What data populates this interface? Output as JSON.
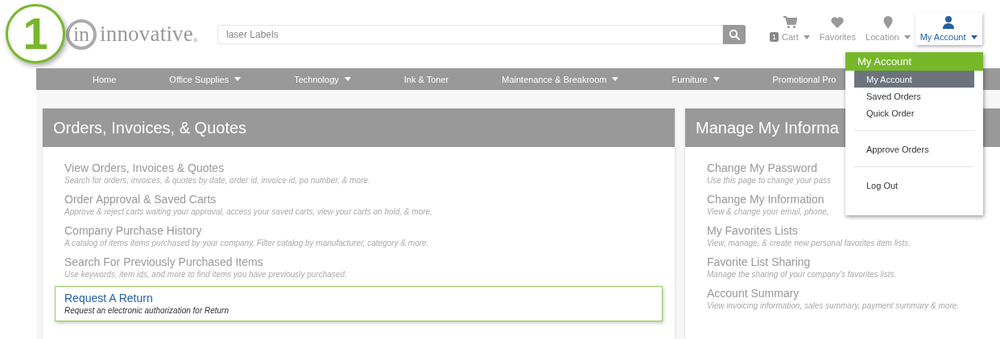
{
  "step_badge": "1",
  "logo": {
    "mark": "in",
    "name": "innovative",
    "reg": "®"
  },
  "search": {
    "value": "laser Labels"
  },
  "header_links": [
    {
      "kind": "cart",
      "count": "1",
      "label": "Cart",
      "caret": true,
      "selected": false
    },
    {
      "kind": "heart",
      "label": "Favorites",
      "caret": false,
      "selected": false
    },
    {
      "kind": "pin",
      "label": "Location",
      "caret": true,
      "selected": false
    },
    {
      "kind": "person",
      "label": "My Account",
      "caret": true,
      "selected": true
    }
  ],
  "nav": [
    {
      "label": "Home",
      "caret": false
    },
    {
      "label": "Office Supplies",
      "caret": true
    },
    {
      "label": "Technology",
      "caret": true
    },
    {
      "label": "Ink & Toner",
      "caret": false
    },
    {
      "label": "Maintenance & Breakroom",
      "caret": true
    },
    {
      "label": "Furniture",
      "caret": true
    },
    {
      "label": "Promotional Pro",
      "caret": false
    }
  ],
  "cards": [
    {
      "title": "Orders, Invoices, & Quotes",
      "items": [
        {
          "title": "View Orders, Invoices & Quotes",
          "description": "Search for orders, invoices, & quotes by date, order id, invoice id, po number, & more.",
          "selected": false
        },
        {
          "title": "Order Approval & Saved Carts",
          "description": "Approve & reject carts waiting your approval, access your saved carts, view your carts on hold, & more.",
          "selected": false
        },
        {
          "title": "Company Purchase History",
          "description": "A catalog of items items purchased by your company. Filter catalog by manufacturer, category & more.",
          "selected": false
        },
        {
          "title": "Search For Previously Purchased Items",
          "description": "Use keywords, item ids, and more to find items you have previously purchased.",
          "selected": false
        },
        {
          "title": "Request A Return",
          "description": "Request an electronic authorization for Return",
          "selected": true
        }
      ]
    },
    {
      "title": "Manage My Informa",
      "items": [
        {
          "title": "Change My Password",
          "description": "Use this page to change your pass",
          "selected": false
        },
        {
          "title": "Change My Information",
          "description": "View & change your email, phone,",
          "selected": false
        },
        {
          "title": "My Favorites Lists",
          "description": "View, manage, & create new personal favorites item lists.",
          "selected": false
        },
        {
          "title": "Favorite List Sharing",
          "description": "Manage the sharing of your company's favorites lists.",
          "selected": false
        },
        {
          "title": "Account Summary",
          "description": "View invoicing information, sales summary, payment summary & more.",
          "selected": false
        }
      ]
    }
  ],
  "account_menu": {
    "title": "My Account",
    "groups": [
      [
        {
          "label": "My Account",
          "selected": true
        },
        {
          "label": "Saved Orders",
          "selected": false
        },
        {
          "label": "Quick Order",
          "selected": false
        }
      ],
      [
        {
          "label": "Approve Orders",
          "selected": false
        }
      ],
      [
        {
          "label": "Log Out",
          "selected": false
        }
      ]
    ]
  }
}
